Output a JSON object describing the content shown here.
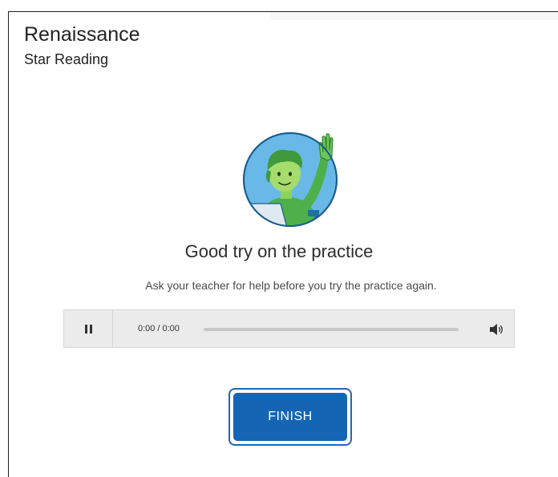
{
  "header": {
    "brand": "Renaissance",
    "product": "Star Reading"
  },
  "main": {
    "headline": "Good try on the practice",
    "instruction": "Ask your teacher for help before you try the practice again.",
    "illustration_icon": "student-raising-hand-icon"
  },
  "audio_player": {
    "pause_icon": "pause-icon",
    "current_time": "0:00",
    "separator": "/",
    "duration": "0:00",
    "progress_fraction": 0,
    "volume_icon": "speaker-volume-icon"
  },
  "actions": {
    "finish_label": "FINISH"
  },
  "colors": {
    "accent": "#1565b5",
    "avatar_background": "#66b8e6",
    "avatar_skin": "#8bc34a",
    "avatar_shirt": "#4caf50"
  }
}
